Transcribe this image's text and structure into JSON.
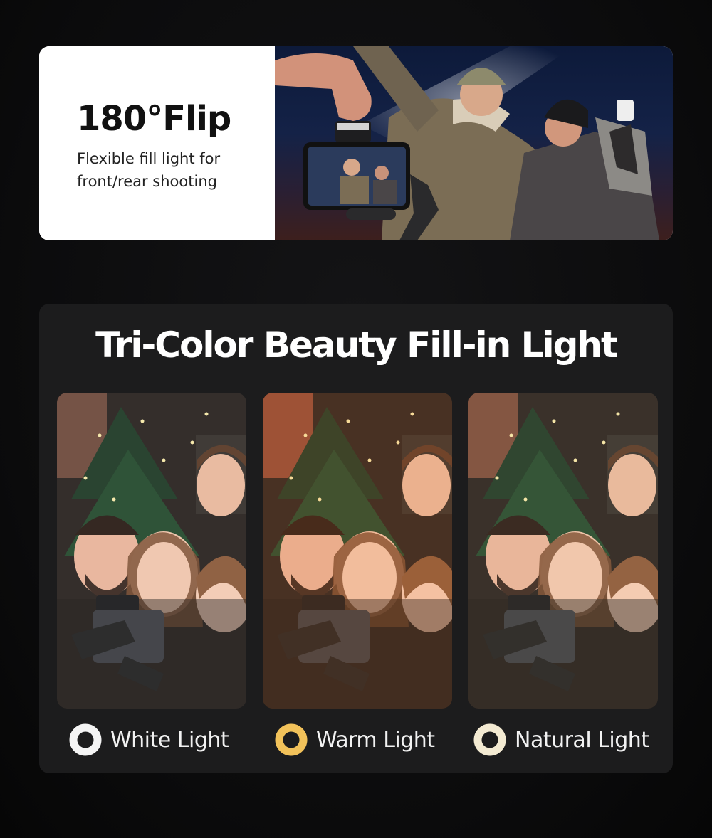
{
  "banner": {
    "title": "180°Flip",
    "description": "Flexible fill light for front/rear shooting"
  },
  "section": {
    "title": "Tri-Color Beauty Fill-in Light"
  },
  "modes": [
    {
      "label": "White Light",
      "ring_color": "#f4f4f4",
      "tint": "#ffffff"
    },
    {
      "label": "Warm Light",
      "ring_color": "#f2c25a",
      "tint": "#ff9a4a"
    },
    {
      "label": "Natural Light",
      "ring_color": "#f3ead2",
      "tint": "#ffe2b8"
    }
  ]
}
